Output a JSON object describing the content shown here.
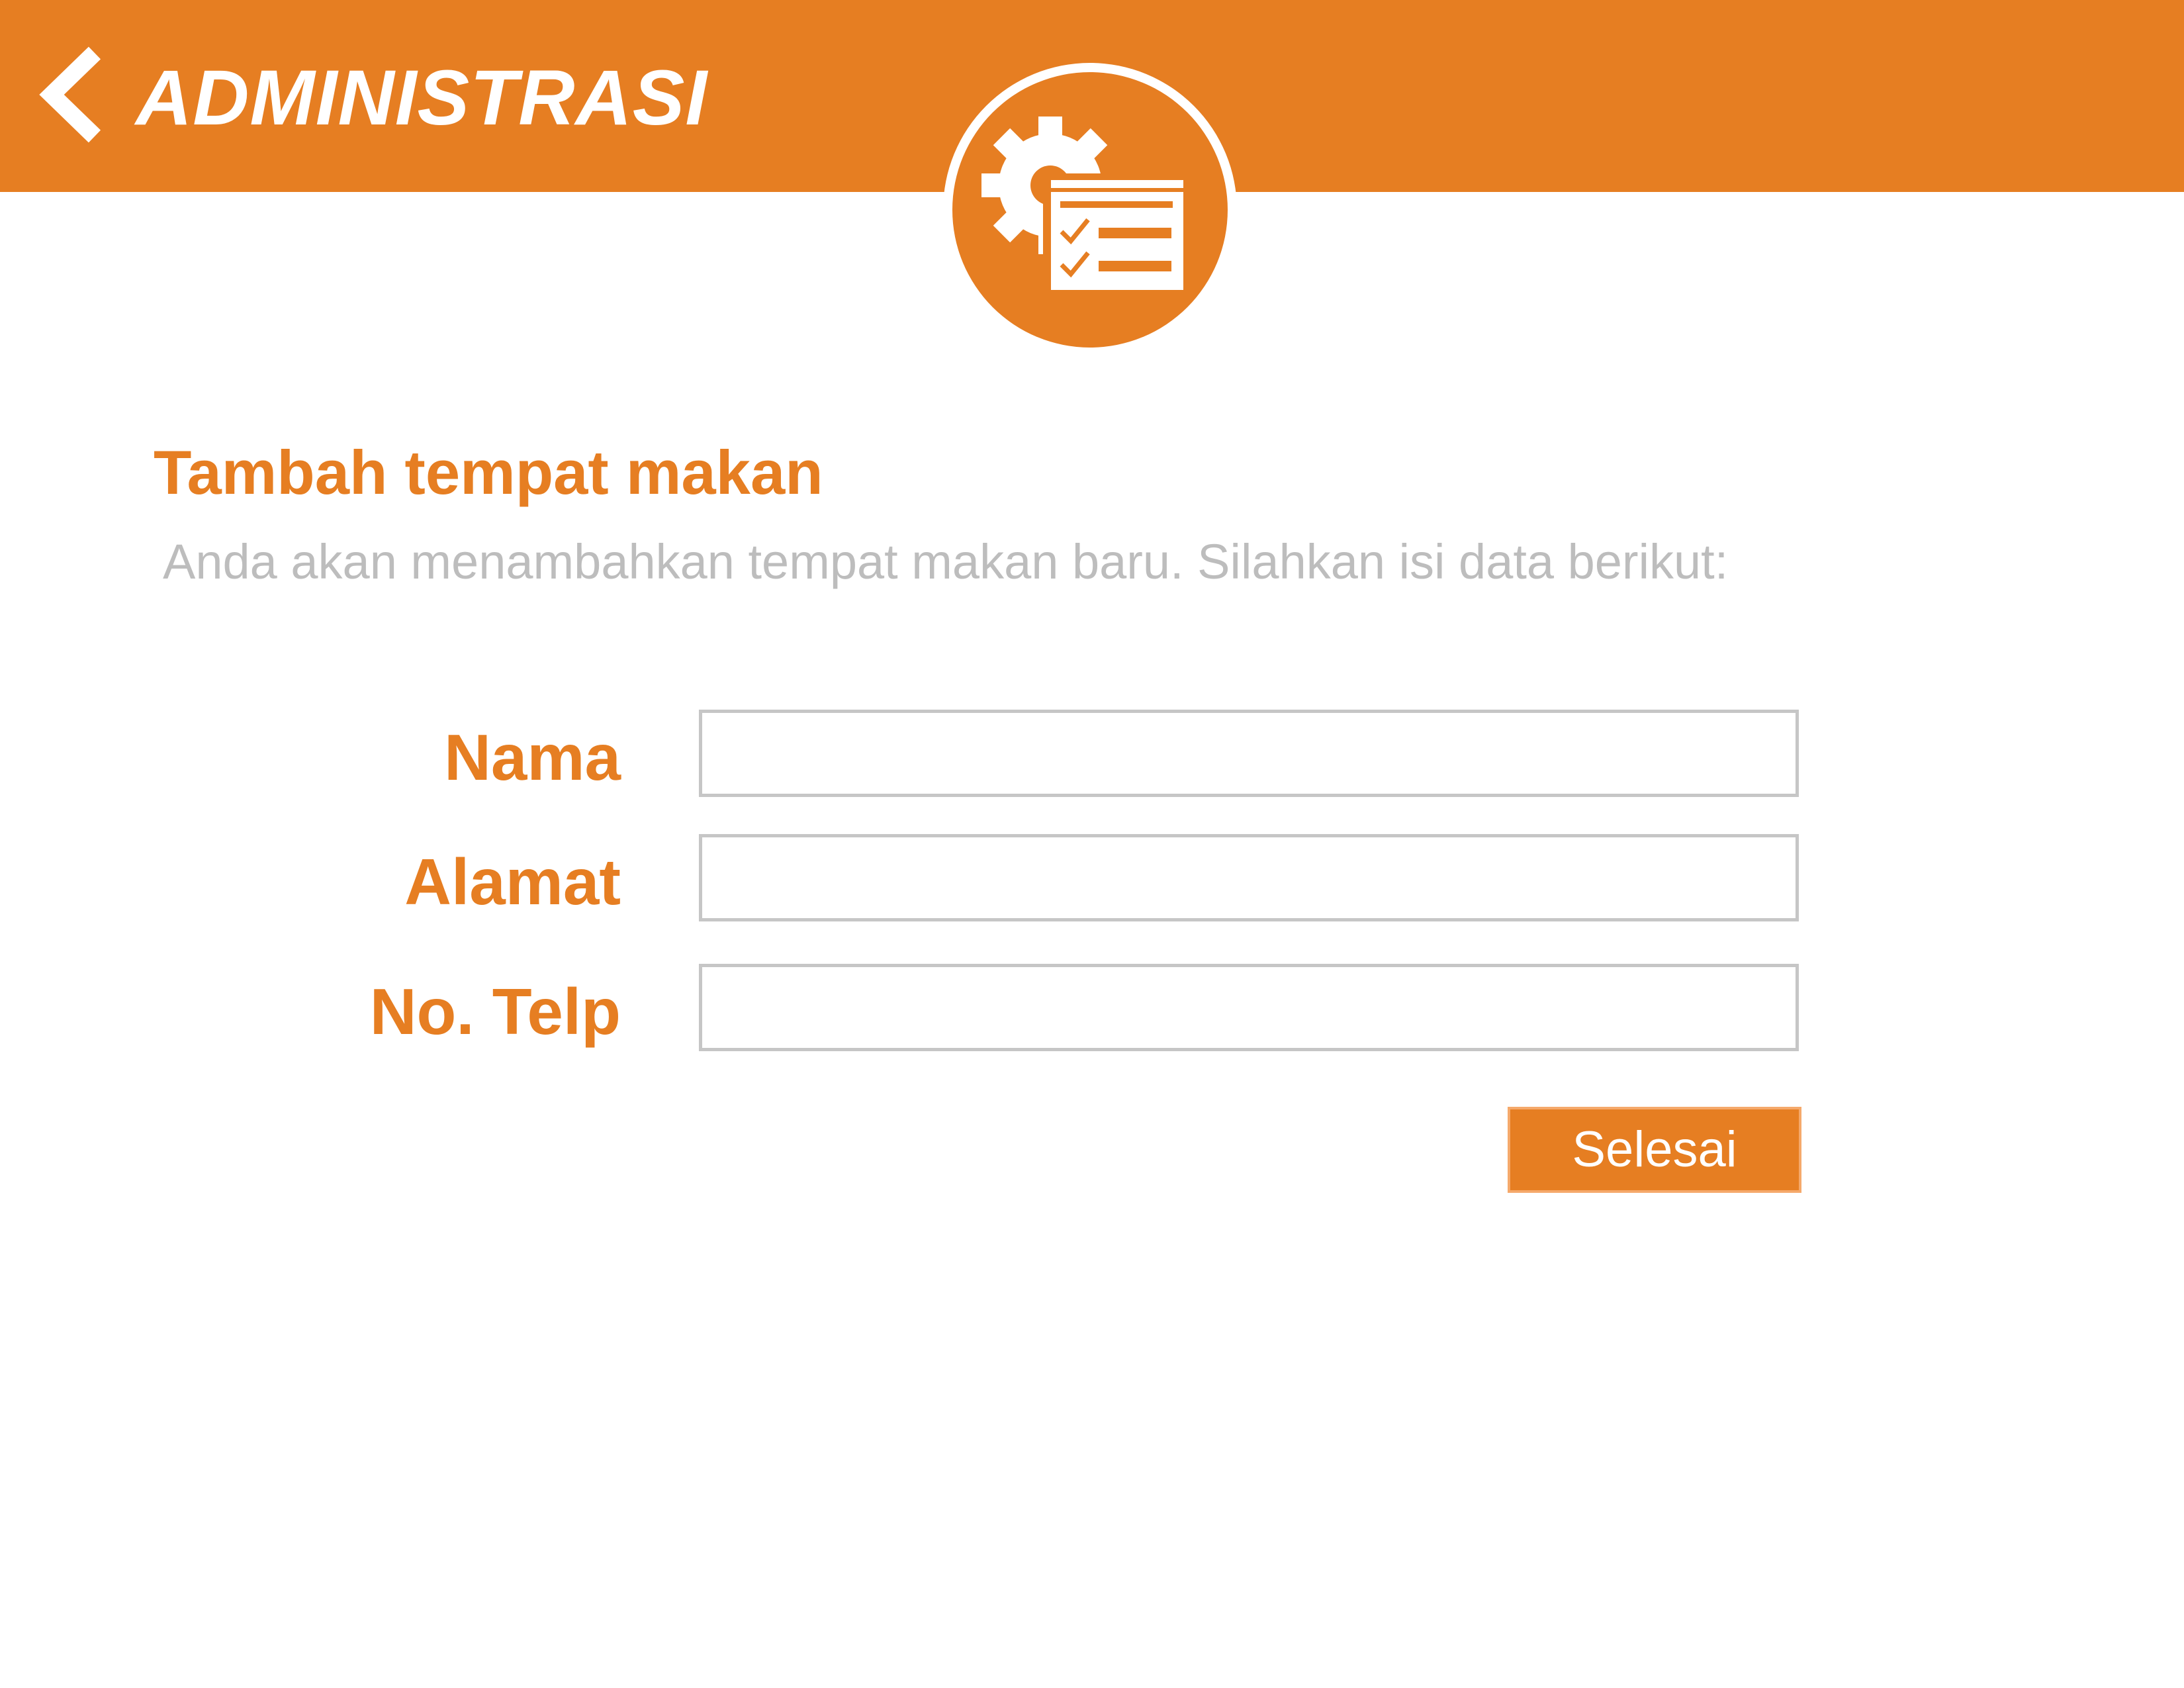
{
  "header": {
    "title": "ADMINISTRASI",
    "back_icon": "chevron-left-icon",
    "emblem_icon": "gear-checklist-icon"
  },
  "form": {
    "heading": "Tambah tempat makan",
    "subtitle": "Anda akan menambahkan tempat makan baru. Silahkan isi data berikut:",
    "fields": [
      {
        "label": "Nama",
        "value": "",
        "placeholder": ""
      },
      {
        "label": "Alamat",
        "value": "",
        "placeholder": ""
      },
      {
        "label": "No. Telp",
        "value": "",
        "placeholder": ""
      }
    ],
    "submit_label": "Selesai"
  },
  "colors": {
    "accent": "#E67E22",
    "muted_text": "#BDBDBD",
    "field_border": "#C6C6C6",
    "background": "#FFFFFF"
  }
}
